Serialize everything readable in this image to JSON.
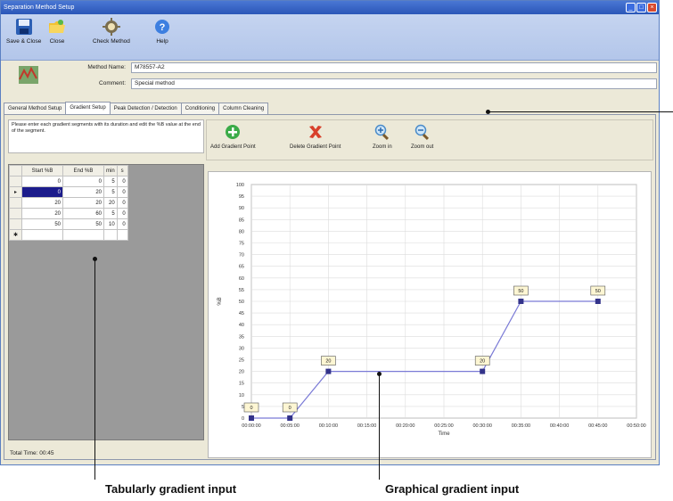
{
  "window": {
    "title": "Separation Method Setup"
  },
  "toolbar": {
    "save_close": "Save & Close",
    "close": "Close",
    "check_method": "Check Method",
    "help": "Help"
  },
  "method": {
    "name_label": "Method Name:",
    "name_value": "M78557-A2",
    "comment_label": "Comment:",
    "comment_value": "Special method"
  },
  "tabs": [
    {
      "label": "General Method Setup",
      "active": false
    },
    {
      "label": "Gradient Setup",
      "active": true
    },
    {
      "label": "Peak Detection / Detection",
      "active": false
    },
    {
      "label": "Conditioning",
      "active": false
    },
    {
      "label": "Column Cleaning",
      "active": false
    }
  ],
  "instruction": "Please enter each gradient segments with its duration and edit the %B value at the end of the segment.",
  "gradient_toolbar": {
    "add": "Add Gradient Point",
    "delete": "Delete Gradient Point",
    "zoom_in": "Zoom in",
    "zoom_out": "Zoom out"
  },
  "table": {
    "headers": [
      "",
      "Start %B",
      "End %B",
      "min",
      "s"
    ],
    "rows": [
      {
        "marker": "",
        "start": "0",
        "end": "0",
        "min": "5",
        "s": "0"
      },
      {
        "marker": "▸",
        "start": "0",
        "end": "20",
        "min": "5",
        "s": "0"
      },
      {
        "marker": "",
        "start": "20",
        "end": "20",
        "min": "20",
        "s": "0"
      },
      {
        "marker": "",
        "start": "20",
        "end": "60",
        "min": "5",
        "s": "0"
      },
      {
        "marker": "",
        "start": "50",
        "end": "50",
        "min": "10",
        "s": "0"
      },
      {
        "marker": "✱",
        "start": "",
        "end": "",
        "min": "",
        "s": ""
      }
    ]
  },
  "total_time": "Total Time: 00:45",
  "chart_data": {
    "type": "line",
    "ylabel": "%B",
    "xlabel": "Time",
    "ylim": [
      0,
      100
    ],
    "yticks": [
      "100",
      "95",
      "90",
      "85",
      "80",
      "75",
      "70",
      "65",
      "60",
      "55",
      "50",
      "45",
      "40",
      "35",
      "30",
      "25",
      "20",
      "15",
      "10",
      "5",
      "0"
    ],
    "xticks": [
      "00:00:00",
      "00:05:00",
      "00:10:00",
      "00:15:00",
      "00:20:00",
      "00:25:00",
      "00:30:00",
      "00:35:00",
      "00:40:00",
      "00:45:00",
      "00:50:00"
    ],
    "series": [
      {
        "x": [
          "00:00:00",
          "00:05:00",
          "00:10:00",
          "00:30:00",
          "00:35:00",
          "00:45:00"
        ],
        "y": [
          0,
          0,
          20,
          20,
          50,
          50
        ],
        "point_labels": [
          "0",
          "0",
          "20",
          "20",
          "50",
          "50"
        ]
      }
    ],
    "grid": true,
    "line_color": "#7a7ad6",
    "marker_color": "#33338a"
  },
  "captions": {
    "tabular": "Tabularly gradient input",
    "graphical": "Graphical gradient input"
  }
}
